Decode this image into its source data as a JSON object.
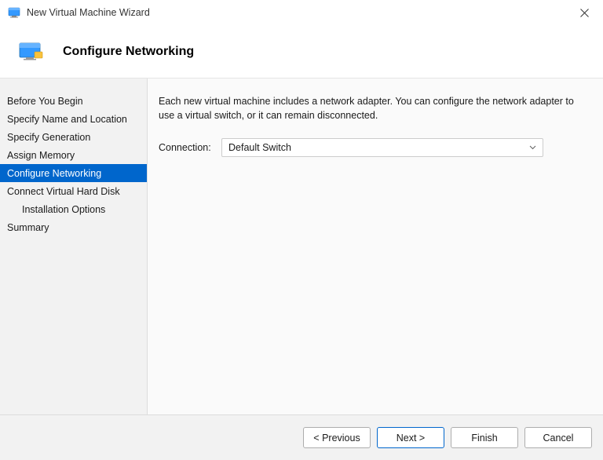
{
  "window": {
    "title": "New Virtual Machine Wizard"
  },
  "header": {
    "title": "Configure Networking"
  },
  "sidebar": {
    "items": [
      {
        "label": "Before You Begin",
        "active": false,
        "indent": false
      },
      {
        "label": "Specify Name and Location",
        "active": false,
        "indent": false
      },
      {
        "label": "Specify Generation",
        "active": false,
        "indent": false
      },
      {
        "label": "Assign Memory",
        "active": false,
        "indent": false
      },
      {
        "label": "Configure Networking",
        "active": true,
        "indent": false
      },
      {
        "label": "Connect Virtual Hard Disk",
        "active": false,
        "indent": false
      },
      {
        "label": "Installation Options",
        "active": false,
        "indent": true
      },
      {
        "label": "Summary",
        "active": false,
        "indent": false
      }
    ]
  },
  "content": {
    "description": "Each new virtual machine includes a network adapter. You can configure the network adapter to use a virtual switch, or it can remain disconnected.",
    "connection_label": "Connection:",
    "connection_value": "Default Switch"
  },
  "footer": {
    "previous": "< Previous",
    "next": "Next >",
    "finish": "Finish",
    "cancel": "Cancel"
  }
}
